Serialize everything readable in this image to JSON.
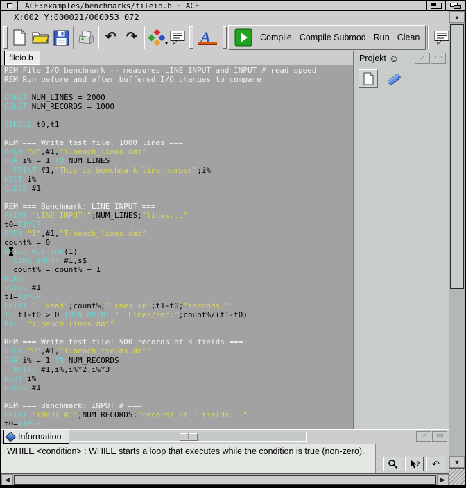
{
  "window": {
    "title": "ACE:examples/benchmarks/fileio.b · ACE"
  },
  "statusbar": {
    "position": "X:002 Y:000021/000053 072"
  },
  "toolbar": {
    "actions": {
      "compile": "Compile",
      "compile_submod": "Compile Submod",
      "run": "Run",
      "clean": "Clean"
    },
    "icon_names": [
      "new-document",
      "open-file",
      "save-file",
      "print",
      "undo",
      "redo",
      "syntax-colors",
      "comment-bubble",
      "ace-logo",
      "run-script",
      "help-bubble"
    ]
  },
  "glyphs": {
    "undo": "↶",
    "redo": "↷",
    "dropdown": "▾",
    "smiley": "☺",
    "scroll_up": "▲",
    "scroll_down": "▼",
    "scroll_left": "◀",
    "scroll_right": "▶",
    "splitter_up": "▲",
    "splitter_down": "▼",
    "gadget_expand": "↗",
    "undo_button": "↶"
  },
  "editor": {
    "tab": "fileio.b",
    "cursor": {
      "column": 2,
      "line": 21,
      "total_lines": 53
    },
    "colors": {
      "background": "#a2a2a2",
      "k": "#70d4d0",
      "s": "#d8d858",
      "c": "#f2f2f2",
      "p": "#000000",
      "cursor_bg": "#000000",
      "cursor_fg": "#ffffff"
    },
    "lines": [
      [
        {
          "c": "c",
          "t": "REM File I/O benchmark -- measures LINE INPUT and INPUT # read speed"
        }
      ],
      [
        {
          "c": "c",
          "t": "REM Run before and after buffered I/O changes to compare"
        }
      ],
      [],
      [
        {
          "c": "k",
          "t": "CONST"
        },
        {
          "c": "p",
          "t": " NUM_LINES = 2000"
        }
      ],
      [
        {
          "c": "k",
          "t": "CONST"
        },
        {
          "c": "p",
          "t": " NUM_RECORDS = 1000"
        }
      ],
      [],
      [
        {
          "c": "k",
          "t": "SINGLE"
        },
        {
          "c": "p",
          "t": " t0,t1"
        }
      ],
      [],
      [
        {
          "c": "c",
          "t": "REM === Write test file: 1000 lines ==="
        }
      ],
      [
        {
          "c": "k",
          "t": "OPEN"
        },
        {
          "c": "p",
          "t": " "
        },
        {
          "c": "s",
          "t": "\"O\""
        },
        {
          "c": "p",
          "t": ",#1,"
        },
        {
          "c": "s",
          "t": "\"T:bench_lines.dat\""
        }
      ],
      [
        {
          "c": "k",
          "t": "FOR"
        },
        {
          "c": "p",
          "t": " i% = 1 "
        },
        {
          "c": "k",
          "t": "TO"
        },
        {
          "c": "p",
          "t": " NUM_LINES"
        }
      ],
      [
        {
          "c": "p",
          "t": "  "
        },
        {
          "c": "k",
          "t": "PRINT"
        },
        {
          "c": "p",
          "t": " #1,"
        },
        {
          "c": "s",
          "t": "\"This is benchmark line number\""
        },
        {
          "c": "p",
          "t": ";i%"
        }
      ],
      [
        {
          "c": "k",
          "t": "NEXT"
        },
        {
          "c": "p",
          "t": " i%"
        }
      ],
      [
        {
          "c": "k",
          "t": "CLOSE"
        },
        {
          "c": "p",
          "t": " #1"
        }
      ],
      [],
      [
        {
          "c": "c",
          "t": "REM === Benchmark: LINE INPUT ==="
        }
      ],
      [
        {
          "c": "k",
          "t": "PRINT"
        },
        {
          "c": "p",
          "t": " "
        },
        {
          "c": "s",
          "t": "\"LINE INPUT:\""
        },
        {
          "c": "p",
          "t": ";NUM_LINES;"
        },
        {
          "c": "s",
          "t": "\"lines...\""
        }
      ],
      [
        {
          "c": "p",
          "t": "t0="
        },
        {
          "c": "k",
          "t": "TIMER"
        }
      ],
      [
        {
          "c": "k",
          "t": "OPEN"
        },
        {
          "c": "p",
          "t": " "
        },
        {
          "c": "s",
          "t": "\"I\""
        },
        {
          "c": "p",
          "t": ",#1,"
        },
        {
          "c": "s",
          "t": "\"T:bench_lines.dat\""
        }
      ],
      [
        {
          "c": "p",
          "t": "count% = 0"
        }
      ],
      [
        {
          "c": "k",
          "t": "W"
        },
        {
          "c": "cur",
          "t": "H"
        },
        {
          "c": "k",
          "t": "ILE NOT EOF"
        },
        {
          "c": "p",
          "t": "(1)"
        }
      ],
      [
        {
          "c": "p",
          "t": "  "
        },
        {
          "c": "k",
          "t": "LINE INPUT"
        },
        {
          "c": "p",
          "t": " #1,s$"
        }
      ],
      [
        {
          "c": "p",
          "t": "  count% = count% + 1"
        }
      ],
      [
        {
          "c": "k",
          "t": "WEND"
        }
      ],
      [
        {
          "c": "k",
          "t": "CLOSE"
        },
        {
          "c": "p",
          "t": " #1"
        }
      ],
      [
        {
          "c": "p",
          "t": "t1="
        },
        {
          "c": "k",
          "t": "TIMER"
        }
      ],
      [
        {
          "c": "k",
          "t": "PRINT"
        },
        {
          "c": "p",
          "t": " "
        },
        {
          "c": "s",
          "t": "\"  Read\""
        },
        {
          "c": "p",
          "t": ";count%;"
        },
        {
          "c": "s",
          "t": "\"lines in\""
        },
        {
          "c": "p",
          "t": ";t1-t0;"
        },
        {
          "c": "s",
          "t": "\"seconds.\""
        }
      ],
      [
        {
          "c": "k",
          "t": "IF"
        },
        {
          "c": "p",
          "t": " t1-t0 > 0 "
        },
        {
          "c": "k",
          "t": "THEN PRINT"
        },
        {
          "c": "p",
          "t": " "
        },
        {
          "c": "s",
          "t": "\"  Lines/sec:\""
        },
        {
          "c": "p",
          "t": ";count%/(t1-t0)"
        }
      ],
      [
        {
          "c": "k",
          "t": "KILL"
        },
        {
          "c": "p",
          "t": " "
        },
        {
          "c": "s",
          "t": "\"T:bench_lines.dat\""
        }
      ],
      [],
      [
        {
          "c": "c",
          "t": "REM === Write test file: 500 records of 3 fields ==="
        }
      ],
      [
        {
          "c": "k",
          "t": "OPEN"
        },
        {
          "c": "p",
          "t": " "
        },
        {
          "c": "s",
          "t": "\"O\""
        },
        {
          "c": "p",
          "t": ",#1,"
        },
        {
          "c": "s",
          "t": "\"T:bench_fields.dat\""
        }
      ],
      [
        {
          "c": "k",
          "t": "FOR"
        },
        {
          "c": "p",
          "t": " i% = 1 "
        },
        {
          "c": "k",
          "t": "TO"
        },
        {
          "c": "p",
          "t": " NUM_RECORDS"
        }
      ],
      [
        {
          "c": "p",
          "t": "  "
        },
        {
          "c": "k",
          "t": "WRITE"
        },
        {
          "c": "p",
          "t": " #1,i%,i%*2,i%*3"
        }
      ],
      [
        {
          "c": "k",
          "t": "NEXT"
        },
        {
          "c": "p",
          "t": " i%"
        }
      ],
      [
        {
          "c": "k",
          "t": "CLOSE"
        },
        {
          "c": "p",
          "t": " #1"
        }
      ],
      [],
      [
        {
          "c": "c",
          "t": "REM === Benchmark: INPUT # ==="
        }
      ],
      [
        {
          "c": "k",
          "t": "PRINT"
        },
        {
          "c": "p",
          "t": " "
        },
        {
          "c": "s",
          "t": "\"INPUT #:\""
        },
        {
          "c": "p",
          "t": ";NUM_RECORDS;"
        },
        {
          "c": "s",
          "t": "\"records of 3 fields...\""
        }
      ],
      [
        {
          "c": "p",
          "t": "t0="
        },
        {
          "c": "k",
          "t": "TIMER"
        }
      ]
    ]
  },
  "project_panel": {
    "title": "Projekt"
  },
  "info_panel": {
    "tab": "Information",
    "help_text": "WHILE <condition> : WHILE starts a loop that executes while the condition is true (non-zero)."
  }
}
